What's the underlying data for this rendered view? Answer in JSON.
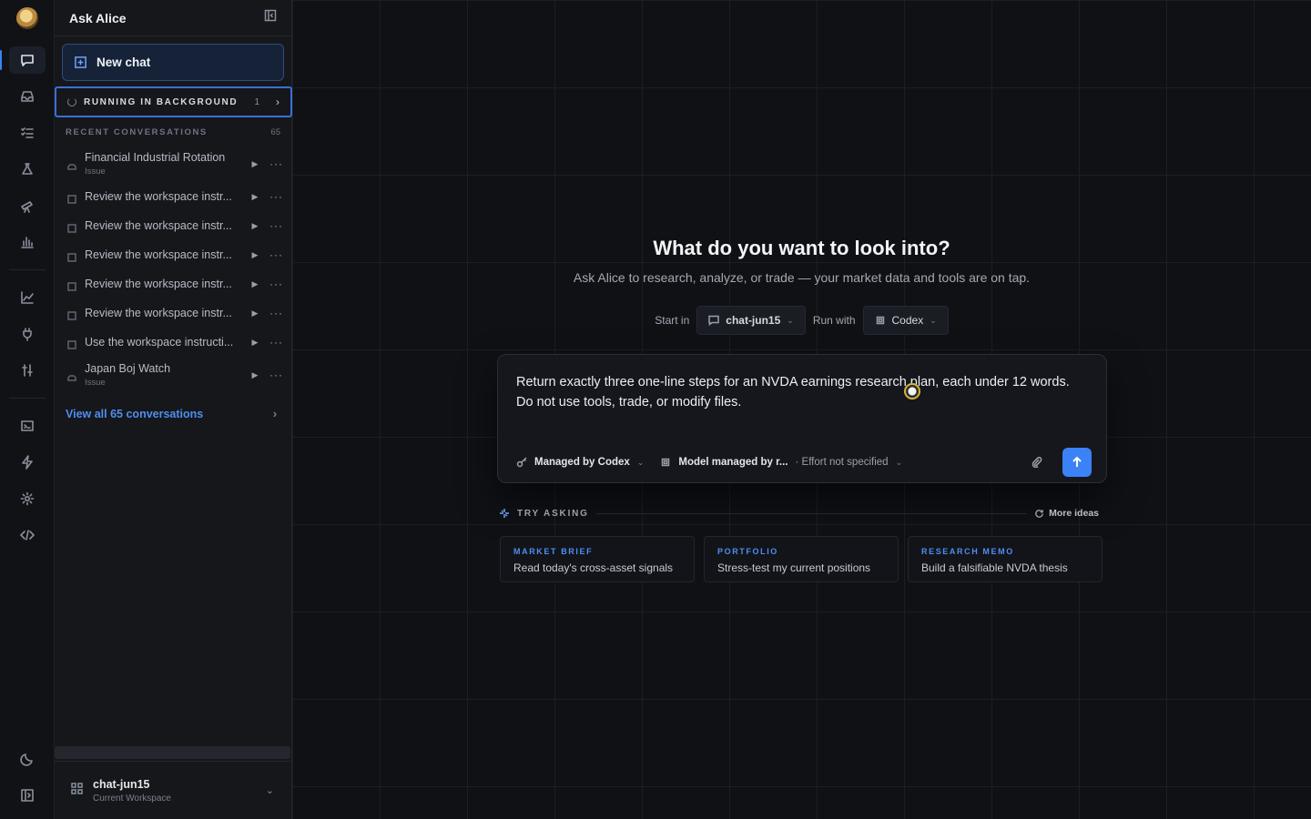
{
  "sidebar": {
    "title": "Ask Alice",
    "new_chat": "New chat",
    "running": {
      "label": "RUNNING IN BACKGROUND",
      "count": "1"
    },
    "recent": {
      "label": "RECENT CONVERSATIONS",
      "count": "65"
    },
    "conversations": [
      {
        "title": "Financial Industrial Rotation",
        "sub": "Issue"
      },
      {
        "title": "Review the workspace instr...",
        "sub": ""
      },
      {
        "title": "Review the workspace instr...",
        "sub": ""
      },
      {
        "title": "Review the workspace instr...",
        "sub": ""
      },
      {
        "title": "Review the workspace instr...",
        "sub": ""
      },
      {
        "title": "Review the workspace instr...",
        "sub": ""
      },
      {
        "title": "Use the workspace instructi...",
        "sub": ""
      },
      {
        "title": "Japan Boj Watch",
        "sub": "Issue"
      }
    ],
    "view_all": "View all 65 conversations",
    "workspace": {
      "name": "chat-jun15",
      "sub": "Current Workspace"
    }
  },
  "main": {
    "title": "What do you want to look into?",
    "subtitle": "Ask Alice to research, analyze, or trade — your market data and tools are on tap.",
    "start_in_label": "Start in",
    "start_in_value": "chat-jun15",
    "run_with_label": "Run with",
    "run_with_value": "Codex",
    "prompt": "Return exactly three one-line steps for an NVDA earnings research plan, each under 12 words. Do not use tools, trade, or modify files.",
    "composer": {
      "managed": "Managed by Codex",
      "model": "Model managed by r...",
      "effort": "· Effort not specified"
    },
    "try_asking": "TRY ASKING",
    "more_ideas": "More ideas",
    "cards": [
      {
        "kicker": "MARKET BRIEF",
        "text": "Read today's cross-asset signals"
      },
      {
        "kicker": "PORTFOLIO",
        "text": "Stress-test my current positions"
      },
      {
        "kicker": "RESEARCH MEMO",
        "text": "Build a falsifiable NVDA thesis"
      }
    ]
  },
  "colors": {
    "accent": "#3b82f6",
    "link": "#4f8ef0",
    "background": "#0f1115"
  }
}
